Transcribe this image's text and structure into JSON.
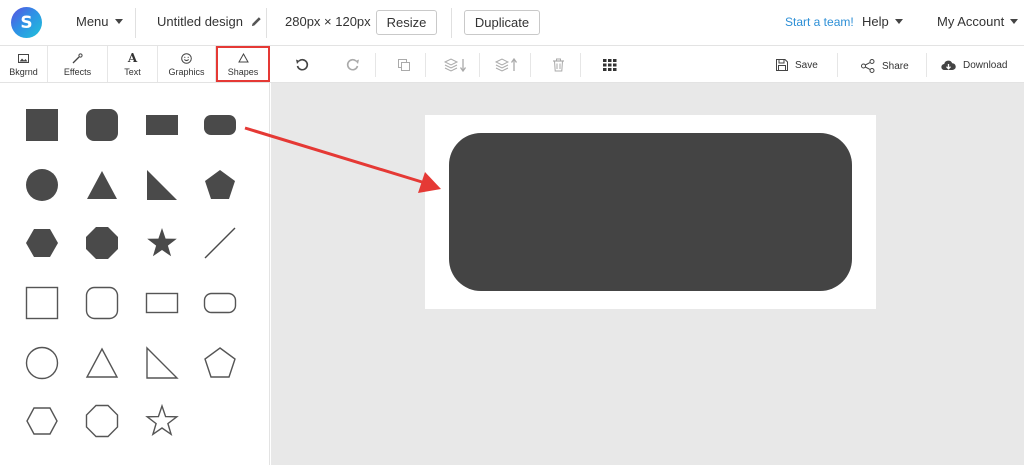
{
  "topbar": {
    "logo_letter": "S",
    "menu_label": "Menu",
    "design_title": "Untitled design",
    "dimensions": "280px × 120px",
    "resize_label": "Resize",
    "duplicate_label": "Duplicate",
    "start_team_label": "Start a team!",
    "help_label": "Help",
    "account_label": "My Account"
  },
  "toolbar": {
    "tabs": [
      {
        "label": "Bkgrnd",
        "icon": "image-icon"
      },
      {
        "label": "Effects",
        "icon": "magic-wand-icon"
      },
      {
        "label": "Text",
        "icon": "text-a-icon"
      },
      {
        "label": "Graphics",
        "icon": "smiley-icon"
      },
      {
        "label": "Shapes",
        "icon": "triangle-icon",
        "active": true
      }
    ],
    "save_label": "Save",
    "share_label": "Share",
    "download_label": "Download"
  },
  "colors": {
    "accent_red": "#e53935",
    "shape_fill": "#4a4a4a",
    "link_blue": "#2d8fd6"
  },
  "shapes": [
    "filled-square",
    "filled-rounded-square",
    "filled-rectangle",
    "filled-rounded-rectangle",
    "filled-circle",
    "filled-triangle",
    "filled-right-triangle",
    "filled-pentagon",
    "filled-hexagon",
    "filled-octagon",
    "filled-star",
    "line",
    "outline-square",
    "outline-rounded-square",
    "outline-rectangle",
    "outline-rounded-rectangle",
    "outline-circle",
    "outline-triangle",
    "outline-right-triangle",
    "outline-pentagon",
    "outline-hexagon",
    "outline-octagon",
    "outline-star"
  ]
}
